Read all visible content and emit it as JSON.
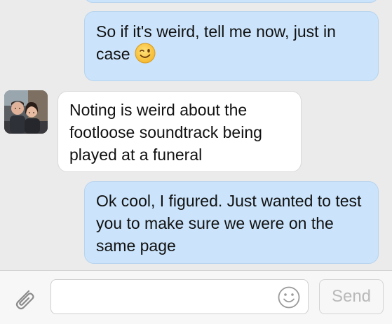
{
  "conversation": {
    "messages": [
      {
        "direction": "outgoing",
        "text": ""
      },
      {
        "direction": "outgoing",
        "text": "So if it's weird, tell me now, just in case",
        "emoji": "wink-emoji"
      },
      {
        "direction": "incoming",
        "text": "Noting is weird about the footloose soundtrack being played at a funeral",
        "avatar": "contact-avatar"
      },
      {
        "direction": "outgoing",
        "text": "Ok cool, I figured. Just wanted to test you to make sure we were on the same page"
      }
    ]
  },
  "composer": {
    "input_value": "",
    "input_placeholder": "",
    "send_label": "Send",
    "attach_icon": "paperclip-icon",
    "emoji_icon": "smiley-icon"
  },
  "colors": {
    "background": "#ebebeb",
    "outgoing_bubble": "#cbe4fb",
    "incoming_bubble": "#ffffff",
    "send_disabled_text": "#b9b9b9"
  }
}
